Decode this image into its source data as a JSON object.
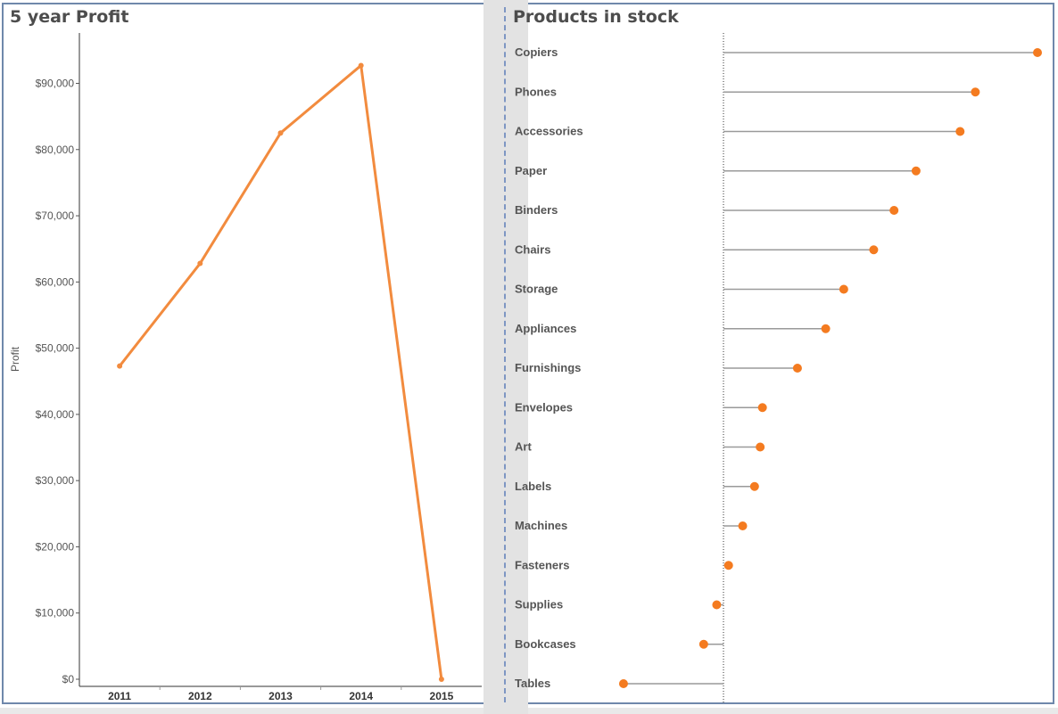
{
  "chart_data": [
    {
      "type": "line",
      "title": "5 year Profit",
      "xlabel": "",
      "ylabel": "Profit",
      "categories": [
        "2011",
        "2012",
        "2013",
        "2014",
        "2015"
      ],
      "values": [
        47300,
        62800,
        82500,
        92700,
        0
      ],
      "ylim": [
        0,
        97000
      ],
      "yticks": [
        0,
        10000,
        20000,
        30000,
        40000,
        50000,
        60000,
        70000,
        80000,
        90000
      ],
      "ytick_labels": [
        "$0",
        "$10,000",
        "$20,000",
        "$30,000",
        "$40,000",
        "$50,000",
        "$60,000",
        "$70,000",
        "$80,000",
        "$90,000"
      ],
      "color": "#f28b3e",
      "grid": false
    },
    {
      "type": "lollipop",
      "title": "Products in stock",
      "xlabel": "",
      "ylabel": "",
      "categories": [
        "Copiers",
        "Phones",
        "Accessories",
        "Paper",
        "Binders",
        "Chairs",
        "Storage",
        "Appliances",
        "Furnishings",
        "Envelopes",
        "Art",
        "Labels",
        "Machines",
        "Fasteners",
        "Supplies",
        "Bookcases",
        "Tables"
      ],
      "values": [
        55600,
        44600,
        41900,
        34100,
        30200,
        26600,
        21300,
        18100,
        13100,
        6900,
        6500,
        5500,
        3400,
        900,
        -1200,
        -3500,
        -17700
      ],
      "xlim": [
        -20000,
        58000
      ],
      "color": "#f47b20",
      "stem_color": "#9a9a9a"
    }
  ]
}
